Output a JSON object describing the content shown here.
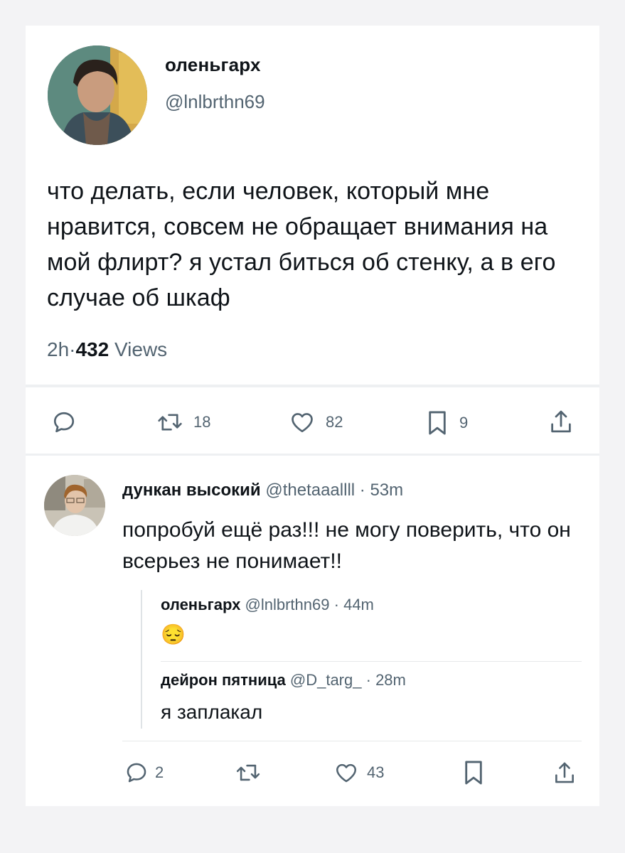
{
  "tweet": {
    "display_name": "оленьгарх",
    "handle": "@lnlbrthn69",
    "text": "что делать, если человек, который мне нравится, совсем не обращает внимания на мой флирт? я устал биться об стенку, а в его случае об шкаф",
    "time": "2h",
    "dot": "·",
    "views_count": "432",
    "views_label": "Views",
    "actions": {
      "reply_count": "",
      "retweet_count": "18",
      "like_count": "82",
      "bookmark_count": "9"
    }
  },
  "reply": {
    "display_name": "дункан высокий",
    "handle": "@thetaaallll",
    "time": "53m",
    "dot": "·",
    "text": "попробуй ещё раз!!! не могу поверить, что он всерьез не понимает!!",
    "quotes": [
      {
        "display_name": "оленьгарх",
        "handle": "@lnlbrthn69",
        "dot": "·",
        "time": "44m",
        "text": "😔"
      },
      {
        "display_name": "дейрон пятница",
        "handle": "@D_targ_",
        "dot": "·",
        "time": "28m",
        "text": "я заплакал"
      }
    ],
    "actions": {
      "reply_count": "2",
      "retweet_count": "",
      "like_count": "43",
      "bookmark_count": ""
    }
  },
  "colors": {
    "text": "#0f1419",
    "secondary": "#536471",
    "background": "#f3f3f5",
    "card": "#ffffff"
  }
}
